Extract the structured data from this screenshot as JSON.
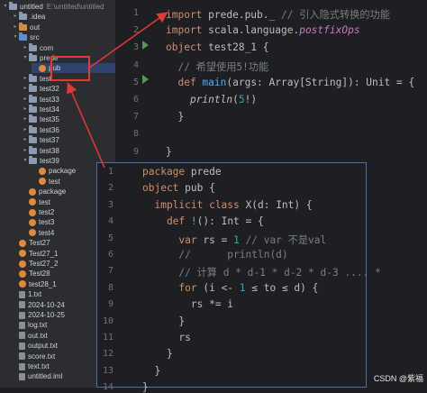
{
  "sidebar": {
    "project_name": "untitled",
    "project_path": "E:\\untitled\\untitled",
    "items": [
      {
        "label": "untitled",
        "extra": "E:\\untitled\\untitled",
        "kind": "folder",
        "depth": 0,
        "arrow": "▾"
      },
      {
        "label": ".idea",
        "kind": "folder",
        "depth": 1,
        "arrow": "▸"
      },
      {
        "label": "out",
        "kind": "folder-orange",
        "depth": 1,
        "arrow": "▸"
      },
      {
        "label": "src",
        "kind": "folder-blue",
        "depth": 1,
        "arrow": "▾"
      },
      {
        "label": "com",
        "kind": "folder",
        "depth": 2,
        "arrow": "▸"
      },
      {
        "label": "prede",
        "kind": "folder",
        "depth": 2,
        "arrow": "▾"
      },
      {
        "label": "pub",
        "kind": "object",
        "depth": 3,
        "arrow": ""
      },
      {
        "label": "test",
        "kind": "folder",
        "depth": 2,
        "arrow": "▸"
      },
      {
        "label": "test32",
        "kind": "folder",
        "depth": 2,
        "arrow": "▸"
      },
      {
        "label": "test33",
        "kind": "folder",
        "depth": 2,
        "arrow": "▸"
      },
      {
        "label": "test34",
        "kind": "folder",
        "depth": 2,
        "arrow": "▸"
      },
      {
        "label": "test35",
        "kind": "folder",
        "depth": 2,
        "arrow": "▸"
      },
      {
        "label": "test36",
        "kind": "folder",
        "depth": 2,
        "arrow": "▸"
      },
      {
        "label": "test37",
        "kind": "folder",
        "depth": 2,
        "arrow": "▸"
      },
      {
        "label": "test38",
        "kind": "folder",
        "depth": 2,
        "arrow": "▸"
      },
      {
        "label": "test39",
        "kind": "folder",
        "depth": 2,
        "arrow": "▾"
      },
      {
        "label": "package",
        "kind": "object",
        "depth": 3,
        "arrow": ""
      },
      {
        "label": "test",
        "kind": "object",
        "depth": 3,
        "arrow": ""
      },
      {
        "label": "package",
        "kind": "object",
        "depth": 2,
        "arrow": ""
      },
      {
        "label": "test",
        "kind": "object",
        "depth": 2,
        "arrow": ""
      },
      {
        "label": "test2",
        "kind": "object",
        "depth": 2,
        "arrow": ""
      },
      {
        "label": "test3",
        "kind": "object",
        "depth": 2,
        "arrow": ""
      },
      {
        "label": "test4",
        "kind": "object",
        "depth": 2,
        "arrow": ""
      },
      {
        "label": "Test27",
        "kind": "object",
        "depth": 1,
        "arrow": ""
      },
      {
        "label": "Test27_1",
        "kind": "object",
        "depth": 1,
        "arrow": ""
      },
      {
        "label": "Test27_2",
        "kind": "object",
        "depth": 1,
        "arrow": ""
      },
      {
        "label": "Test28",
        "kind": "object",
        "depth": 1,
        "arrow": ""
      },
      {
        "label": "test28_1",
        "kind": "object",
        "depth": 1,
        "arrow": ""
      },
      {
        "label": "1.txt",
        "kind": "file",
        "depth": 1,
        "arrow": ""
      },
      {
        "label": "2024-10-24",
        "kind": "file",
        "depth": 1,
        "arrow": ""
      },
      {
        "label": "2024-10-25",
        "kind": "file",
        "depth": 1,
        "arrow": ""
      },
      {
        "label": "log.txt",
        "kind": "file",
        "depth": 1,
        "arrow": ""
      },
      {
        "label": "out.txt",
        "kind": "file",
        "depth": 1,
        "arrow": ""
      },
      {
        "label": "output.txt",
        "kind": "file",
        "depth": 1,
        "arrow": ""
      },
      {
        "label": "score.txt",
        "kind": "file",
        "depth": 1,
        "arrow": ""
      },
      {
        "label": "text.txt",
        "kind": "file",
        "depth": 1,
        "arrow": ""
      },
      {
        "label": "untitled.iml",
        "kind": "file",
        "depth": 1,
        "arrow": ""
      }
    ]
  },
  "editor": {
    "lines": [
      {
        "n": "1",
        "segs": [
          {
            "t": "import ",
            "c": "kw"
          },
          {
            "t": "prede.pub._ ",
            "c": ""
          },
          {
            "t": "// 引入隐式转换的功能",
            "c": "cm"
          }
        ]
      },
      {
        "n": "2",
        "segs": [
          {
            "t": "import ",
            "c": "kw"
          },
          {
            "t": "scala.language.",
            "c": ""
          },
          {
            "t": "postfixOps",
            "c": "sc it"
          }
        ]
      },
      {
        "n": "3",
        "segs": [
          {
            "t": "object ",
            "c": "kw"
          },
          {
            "t": "test28_1 {",
            "c": ""
          }
        ]
      },
      {
        "n": "4",
        "segs": [
          {
            "t": "  // 希望使用5!功能",
            "c": "cm"
          }
        ]
      },
      {
        "n": "5",
        "segs": [
          {
            "t": "  def ",
            "c": "kw"
          },
          {
            "t": "main",
            "c": "fn"
          },
          {
            "t": "(args: Array[String]): Unit = {",
            "c": ""
          }
        ]
      },
      {
        "n": "6",
        "segs": [
          {
            "t": "    ",
            "c": ""
          },
          {
            "t": "println",
            "c": "it"
          },
          {
            "t": "(",
            "c": ""
          },
          {
            "t": "5",
            "c": "num"
          },
          {
            "t": "!)",
            "c": ""
          }
        ]
      },
      {
        "n": "7",
        "segs": [
          {
            "t": "  }",
            "c": ""
          }
        ]
      },
      {
        "n": "8",
        "segs": [
          {
            "t": "",
            "c": ""
          }
        ]
      },
      {
        "n": "9",
        "segs": [
          {
            "t": "}",
            "c": ""
          }
        ]
      }
    ]
  },
  "popup": {
    "lines": [
      {
        "n": "1",
        "segs": [
          {
            "t": "package ",
            "c": "kw"
          },
          {
            "t": "prede",
            "c": ""
          }
        ]
      },
      {
        "n": "2",
        "segs": [
          {
            "t": "object ",
            "c": "kw"
          },
          {
            "t": "pub {",
            "c": ""
          }
        ]
      },
      {
        "n": "3",
        "segs": [
          {
            "t": "  implicit class ",
            "c": "kw"
          },
          {
            "t": "X(d: Int) {",
            "c": ""
          }
        ]
      },
      {
        "n": "4",
        "segs": [
          {
            "t": "    def ",
            "c": "kw"
          },
          {
            "t": "!",
            "c": "fn"
          },
          {
            "t": "(): Int = {",
            "c": ""
          }
        ]
      },
      {
        "n": "5",
        "segs": [
          {
            "t": "      var ",
            "c": "kw"
          },
          {
            "t": "rs = ",
            "c": ""
          },
          {
            "t": "1",
            "c": "num"
          },
          {
            "t": " // var 不是val",
            "c": "cm"
          }
        ]
      },
      {
        "n": "6",
        "segs": [
          {
            "t": "      //      println(d)",
            "c": "cm"
          }
        ]
      },
      {
        "n": "7",
        "segs": [
          {
            "t": "      // 计算 d * d-1 * d-2 * d-3 .... *",
            "c": "cm"
          }
        ]
      },
      {
        "n": "8",
        "segs": [
          {
            "t": "      for ",
            "c": "kw"
          },
          {
            "t": "(i <- ",
            "c": ""
          },
          {
            "t": "1",
            "c": "num"
          },
          {
            "t": " ≤ to ≤ d) {",
            "c": ""
          }
        ]
      },
      {
        "n": "9",
        "segs": [
          {
            "t": "        rs *= i",
            "c": ""
          }
        ]
      },
      {
        "n": "10",
        "segs": [
          {
            "t": "      }",
            "c": ""
          }
        ]
      },
      {
        "n": "11",
        "segs": [
          {
            "t": "      rs",
            "c": ""
          }
        ]
      },
      {
        "n": "12",
        "segs": [
          {
            "t": "    }",
            "c": ""
          }
        ]
      },
      {
        "n": "13",
        "segs": [
          {
            "t": "  }",
            "c": ""
          }
        ]
      },
      {
        "n": "14",
        "segs": [
          {
            "t": "}",
            "c": ""
          }
        ]
      }
    ]
  },
  "watermark": "CSDN @紫福",
  "colors": {
    "annotation": "#e53935",
    "keyword": "#cf8e6d",
    "comment": "#7a7e85",
    "number": "#2aacb8",
    "function": "#56a8f5"
  },
  "icons": {
    "run": "run-gutter-icon",
    "object": "scala-object-icon",
    "folder": "folder-icon"
  }
}
